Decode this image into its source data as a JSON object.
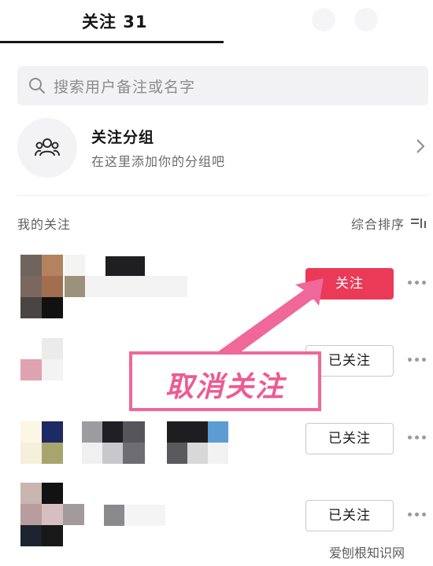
{
  "header": {
    "tab_follow_label": "关注 31"
  },
  "search": {
    "placeholder": "搜索用户备注或名字",
    "icon": "search-icon"
  },
  "group": {
    "title": "关注分组",
    "subtitle": "在这里添加你的分组吧",
    "icon": "people-group-icon"
  },
  "list": {
    "section_label": "我的关注",
    "sort_label": "综合排序",
    "users": [
      {
        "button_label": "关注",
        "state": "not-following"
      },
      {
        "button_label": "已关注",
        "state": "following"
      },
      {
        "button_label": "已关注",
        "state": "following"
      },
      {
        "button_label": "已关注",
        "state": "following"
      }
    ]
  },
  "annotation": {
    "text": "取消关注",
    "color": "#ee5a92"
  },
  "watermark": "爱刨根知识网",
  "colors": {
    "accent": "#ea3a58",
    "annotation": "#f0679a"
  }
}
